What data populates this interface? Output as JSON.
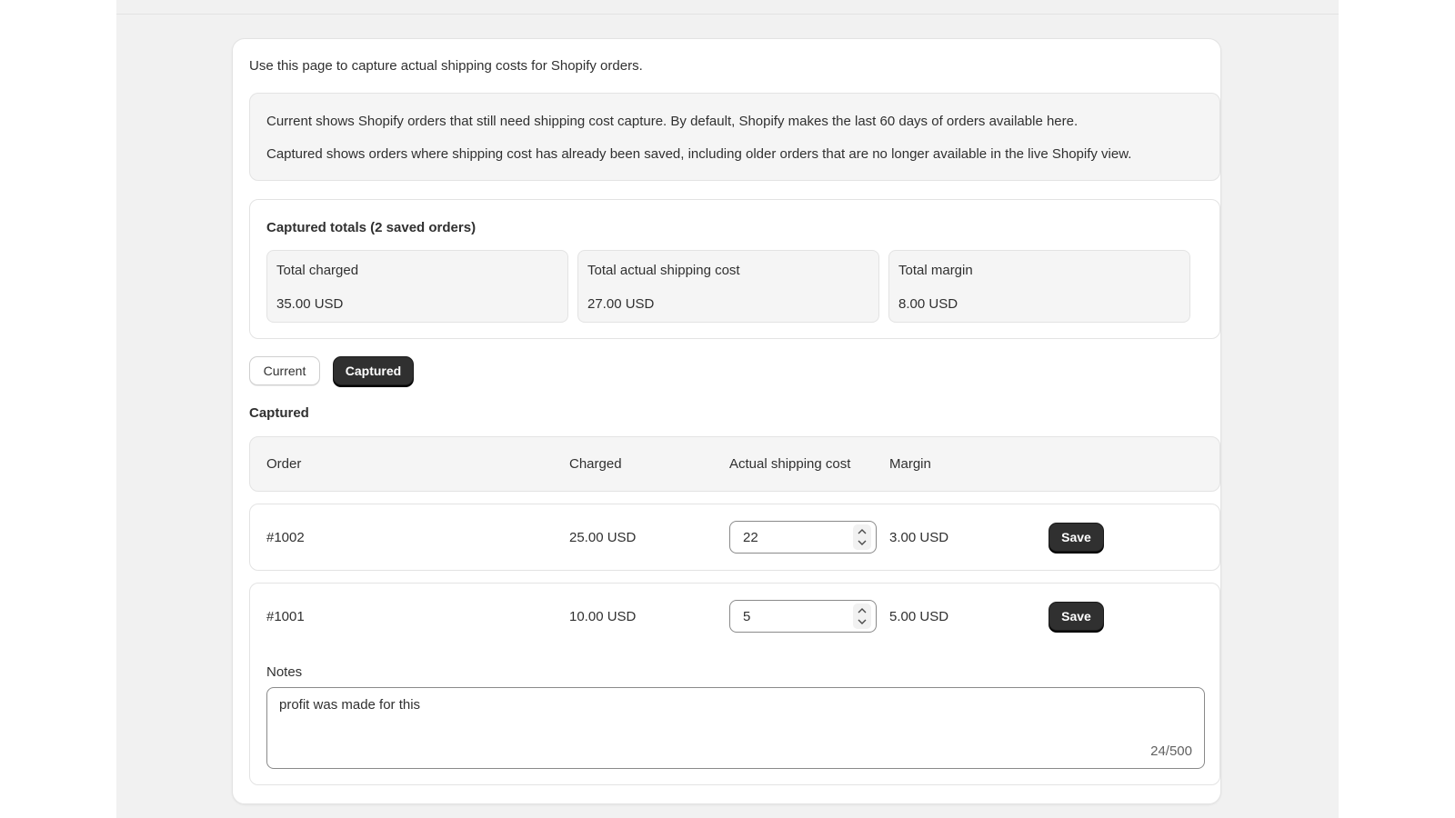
{
  "intro": "Use this page to capture actual shipping costs for Shopify orders.",
  "info": {
    "current_text": "Current shows Shopify orders that still need shipping cost capture. By default, Shopify makes the last 60 days of orders available here.",
    "captured_text": "Captured shows orders where shipping cost has already been saved, including older orders that are no longer available in the live Shopify view."
  },
  "totals": {
    "title": "Captured totals (2 saved orders)",
    "stats": [
      {
        "label": "Total charged",
        "value": "35.00 USD"
      },
      {
        "label": "Total actual shipping cost",
        "value": "27.00 USD"
      },
      {
        "label": "Total margin",
        "value": "8.00 USD"
      }
    ]
  },
  "tabs": {
    "current": "Current",
    "captured": "Captured",
    "selected": "Captured"
  },
  "section_title": "Captured",
  "table": {
    "headers": [
      "Order",
      "Charged",
      "Actual shipping cost",
      "Margin"
    ],
    "rows": [
      {
        "order": "#1002",
        "charged": "25.00 USD",
        "actual": "22",
        "margin": "3.00 USD",
        "save": "Save"
      },
      {
        "order": "#1001",
        "charged": "10.00 USD",
        "actual": "5",
        "margin": "5.00 USD",
        "save": "Save",
        "notes_label": "Notes",
        "notes": "profit was made for this",
        "notes_count": "24/500"
      }
    ]
  }
}
